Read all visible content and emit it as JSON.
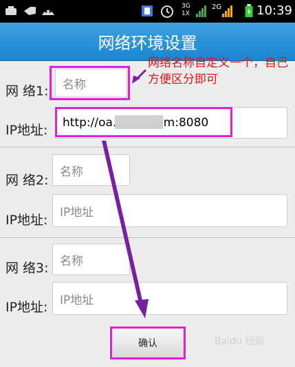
{
  "status_bar": {
    "network_3g_label": "3G\n1X",
    "network_2g_label": "2G",
    "time": "10:39",
    "icons": [
      "usb-icon",
      "sd-icon",
      "android-icon",
      "screenshot-icon",
      "alarm-icon",
      "signal-3g-icon",
      "signal-2g-icon",
      "battery-charging-icon"
    ]
  },
  "header": {
    "title": "网络环境设置"
  },
  "networks": [
    {
      "network_label": "网 络1:",
      "name_placeholder": "名称",
      "ip_label": "IP地址:",
      "ip_value": "http://oa.        .com:8080"
    },
    {
      "network_label": "网 络2:",
      "name_placeholder": "名称",
      "ip_label": "IP地址:",
      "ip_placeholder": "IP地址"
    },
    {
      "network_label": "网 络3:",
      "name_placeholder": "名称",
      "ip_label": "IP地址:",
      "ip_placeholder": "IP地址"
    }
  ],
  "confirm_button": {
    "label": "确认"
  },
  "annotation": {
    "text": "网络名称自定义一个，自己方便区分即可"
  },
  "watermark": {
    "text": "Baidu 经验"
  },
  "colors": {
    "accent": "#1b86d0",
    "highlight": "#e01fd6",
    "annotation": "#e01515"
  }
}
